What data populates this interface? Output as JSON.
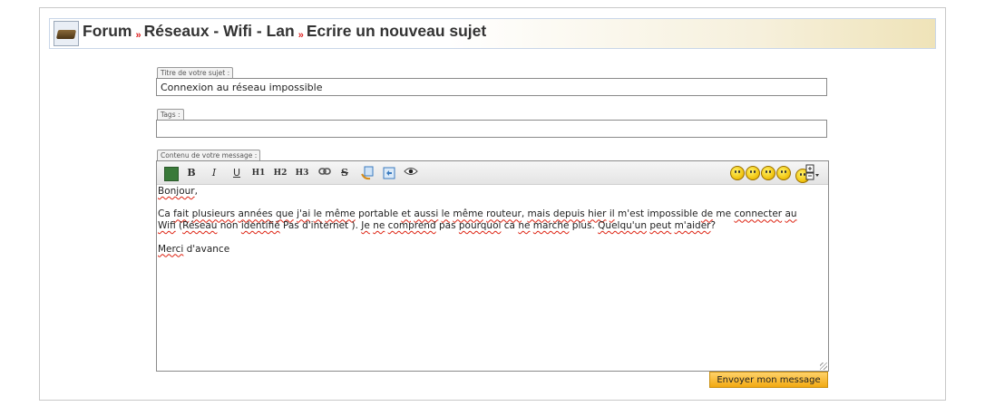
{
  "breadcrumb": {
    "items": [
      "Forum",
      "Réseaux - Wifi - Lan",
      "Ecrire un nouveau sujet"
    ],
    "separator": "»"
  },
  "subject": {
    "label": "Titre de votre sujet :",
    "value": "Connexion au réseau impossible"
  },
  "tags": {
    "label": "Tags :",
    "value": ""
  },
  "content": {
    "label": "Contenu de votre message :",
    "toolbar": {
      "bold": "B",
      "italic": "I",
      "underline": "U",
      "h1": "H1",
      "h2": "H2",
      "h3": "H3",
      "link_icon": "link-icon",
      "strike": "S"
    },
    "message_lines": [
      "Bonjour,",
      "",
      "Ca fait plusieurs années que j'ai le même portable et aussi le même routeur, mais depuis hier il m'est impossible de me connecter au",
      "Wifi (Réseau non identifié Pas d'internet ). Je ne comprend pas pourquoi ca ne marche plus. Quelqu'un peut m'aider?",
      "",
      "Merci d'avance"
    ]
  },
  "submit_label": "Envoyer mon message",
  "colors": {
    "accent_button": "#f2a912",
    "spellcheck": "#d21"
  }
}
